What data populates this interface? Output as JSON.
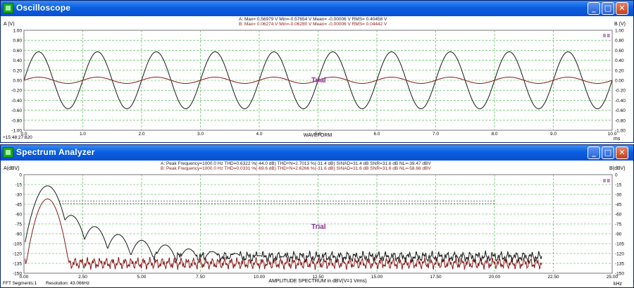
{
  "oscilloscope": {
    "title": "Oscilloscope",
    "stats_a": "A:  Max=  0.56979 V   Min=-0.57654 V   Mean= -0.00006 V   RMS=  0.40458 V",
    "stats_b": "B:  Max=  0.06274 V   Min=-0.06280 V   Mean= -0.00006 V   RMS=  0.04442 V",
    "left_axis_label": "A (V)",
    "right_axis_label": "B (V)",
    "y_ticks": [
      "1.00",
      "0.80",
      "0.60",
      "0.40",
      "0.20",
      "0.00",
      "-0.20",
      "-0.40",
      "-0.60",
      "-0.80",
      "-1.00"
    ],
    "x_ticks": [
      "0.0",
      "1.0",
      "2.0",
      "3.0",
      "4.0",
      "5.0",
      "6.0",
      "7.0",
      "8.0",
      "9.0",
      "10.0"
    ],
    "x_label": "WAVEFORM",
    "x_unit": "ms",
    "timestamp": "+15:48:27:820",
    "watermark": "Trial",
    "channel_tag": "II II"
  },
  "spectrum": {
    "title": "Spectrum Analyzer",
    "stats_a": "A:  Peak Frequency=1000.0 Hz   THD=0.6322 %(-44.0 dB)   THD+N=2.7013 %(-31.4 dB)   SINAD=31.4 dB   SNR=31.6 dB   NL=-39.47 dBV",
    "stats_b": "B:  Peak Frequency=1000.0 Hz   THD=0.0331 %(-69.6 dB)   THD+N=2.6266 %(-31.6 dB)   SINAD=31.6 dB   SNR=31.6 dB   NL=-58.66 dBV",
    "left_axis_label": "A(dBV)",
    "right_axis_label": "B(dBV)",
    "y_ticks": [
      "0",
      "-15",
      "-30",
      "-45",
      "-60",
      "-75",
      "-90",
      "-105",
      "-120",
      "-135",
      "-150"
    ],
    "x_ticks": [
      "0.00",
      "2.50",
      "5.00",
      "7.50",
      "10.00",
      "12.50",
      "15.00",
      "17.50",
      "20.00",
      "22.50",
      "25.00"
    ],
    "x_label": "AMPLITUDE SPECTRUM in dBV(V=1 Vrms)",
    "x_unit": "kHz",
    "fft_segments": "FFT Segments:1",
    "resolution": "Resolution: 43.066Hz",
    "watermark": "Trial",
    "channel_tag": "II II"
  },
  "colors": {
    "grid": "#3fae3f",
    "channel_a": "#1a1a1a",
    "channel_b": "#8a1a1a",
    "watermark": "#8c2a9c",
    "titlebar": "#0b5fe0"
  },
  "chart_data": [
    {
      "type": "line",
      "xlabel": "WAVEFORM",
      "ylabel": "A (V)",
      "xlim": [
        0,
        10
      ],
      "ylim": [
        -1,
        1
      ],
      "grid": true,
      "series": [
        {
          "name": "A",
          "frequency_khz": 1.0,
          "amplitude": 0.57,
          "cycles": 10,
          "start_phase": "rising from 0"
        },
        {
          "name": "B",
          "frequency_khz": 1.0,
          "amplitude": 0.063,
          "cycles": 10,
          "start_phase": "rising from 0"
        }
      ]
    },
    {
      "type": "line",
      "xlabel": "AMPLITUDE SPECTRUM in dBV(V=1 Vrms)",
      "ylabel": "A(dBV)",
      "xlim": [
        0,
        25
      ],
      "ylim": [
        -150,
        0
      ],
      "grid": true,
      "series": [
        {
          "name": "A",
          "fundamental_khz": 1.0,
          "fundamental_dbv": -17,
          "harmonic_peaks_dbv": [
            -62,
            -79,
            -91,
            -100,
            -107,
            -113,
            -117,
            -120,
            -123,
            -125
          ],
          "floor_dbv": -125,
          "end_khz": 22
        },
        {
          "name": "B",
          "fundamental_khz": 1.0,
          "fundamental_dbv": -37,
          "floor_dbv": -135,
          "end_khz": 22
        }
      ],
      "reference_lines_dbv": [
        -40,
        -44
      ]
    }
  ]
}
